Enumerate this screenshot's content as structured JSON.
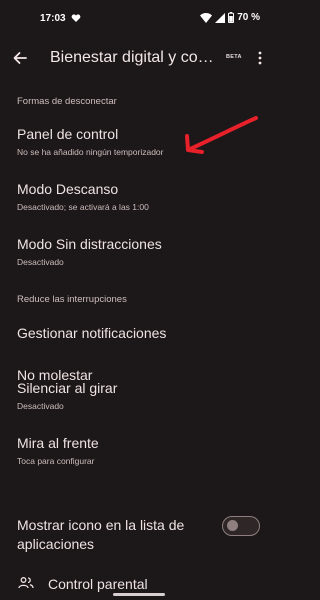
{
  "status_bar": {
    "time": "17:03",
    "battery": "70 %"
  },
  "app_bar": {
    "title": "Bienestar digital y controles parentales",
    "badge": "BETA"
  },
  "section1": {
    "header": "Formas de desconectar",
    "items": [
      {
        "title": "Panel de control",
        "subtitle": "No se ha añadido ningún temporizador"
      },
      {
        "title": "Modo Descanso",
        "subtitle": "Desactivado; se activará a las 1:00"
      },
      {
        "title": "Modo Sin distracciones",
        "subtitle": "Desactivado"
      }
    ]
  },
  "section2": {
    "header": "Reduce las interrupciones",
    "items": [
      {
        "title": "Gestionar notificaciones"
      },
      {
        "title": "No molestar"
      },
      {
        "title": "Silenciar al girar",
        "subtitle": "Desactivado"
      },
      {
        "title": "Mira al frente",
        "subtitle": "Toca para configurar"
      },
      {
        "title_line1": "Mostrar icono en la lista de",
        "title_line2": "aplicaciones",
        "enabled": false
      }
    ]
  },
  "parental": {
    "title": "Control parental"
  },
  "colors": {
    "background": "#1c1718",
    "annotation": "#e8202a"
  }
}
